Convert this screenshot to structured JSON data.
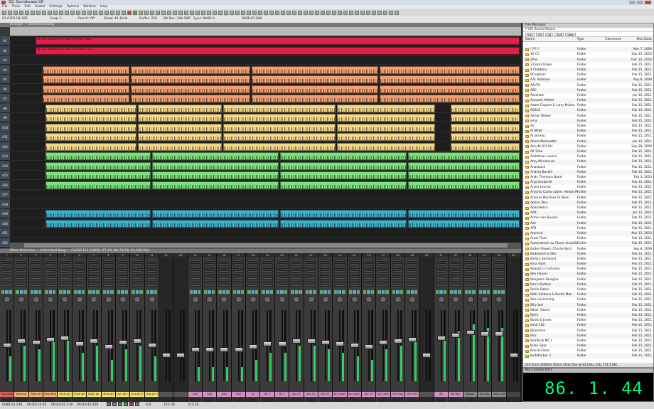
{
  "app": {
    "title": "SQ: Soundscape V8"
  },
  "menu": [
    "File",
    "Track",
    "Edit",
    "Global",
    "Settings",
    "Options",
    "Window",
    "Help"
  ],
  "info": {
    "position": "01 0101.04.285",
    "snap": "Snap: 1",
    "punch": "Punch: Off",
    "show": "Show: 44.1kHz",
    "buffer": "Buffer: 256",
    "bitres": "Bit Res: 24b SWF",
    "sync": "Sync: MADI A",
    "end": "0006.01.000"
  },
  "arrange": {
    "title": "Arrange — Unfinished Song",
    "tracks": [
      "A1",
      "A2",
      "A3",
      "A4",
      "A5",
      "A6",
      "A7",
      "A8",
      "A9",
      "A10",
      "A11",
      "A12",
      "A13",
      "A14",
      "A15",
      "A16",
      "A17",
      "A18",
      "A19",
      "A20",
      "A21",
      "A22"
    ],
    "clip_labels": {
      "red1": "Vox Alt – Autoxm MIO: Send Pre/Post – Mute",
      "red2": "Vox Alt – Autoxm MIO: Multi FX 4 Bank – Ch 4"
    }
  },
  "filebrowser": {
    "title": "File Manager",
    "path": "F:\\05 Runed Music\\",
    "tools": [
      "Sort",
      "Fld",
      "Up",
      "Sort",
      "View"
    ],
    "columns": {
      "name": "Name",
      "type": "Type",
      "comment": "Comment",
      "date": "Mod Date"
    },
    "rows": [
      {
        "name": "..",
        "type": "",
        "date": ""
      },
      {
        "name": "!!!!!!!",
        "type": "Folder",
        "date": "Nov 7, 2009"
      },
      {
        "name": "10 CC",
        "type": "Folder",
        "date": "Sep 15, 2010"
      },
      {
        "name": "2Pac",
        "type": "Folder",
        "date": "Dec 14, 2010"
      },
      {
        "name": "3 Doors Down",
        "type": "Folder",
        "date": "Feb 15, 2011"
      },
      {
        "name": "4 Clubbers",
        "type": "Folder",
        "date": "Feb 15, 2011"
      },
      {
        "name": "8Clubbers",
        "type": "Folder",
        "date": "Feb 15, 2011"
      },
      {
        "name": "A.R. Rahman",
        "type": "Folder",
        "date": "Aug 8, 2009"
      },
      {
        "name": "AALTO",
        "type": "Folder",
        "date": "Feb 15, 2011"
      },
      {
        "name": "ABC",
        "type": "Folder",
        "date": "Feb 15, 2011"
      },
      {
        "name": "Abraham",
        "type": "Folder",
        "date": "Jan 10, 2011"
      },
      {
        "name": "Acoustic Affaire",
        "type": "Folder",
        "date": "Feb 15, 2011"
      },
      {
        "name": "Adam Clayton & Larry Mullen",
        "type": "Folder",
        "date": "Feb 15, 2011"
      },
      {
        "name": "ADELE",
        "type": "Folder",
        "date": "Feb 15, 2011"
      },
      {
        "name": "Adrian Bieber",
        "type": "Folder",
        "date": "Feb 15, 2011"
      },
      {
        "name": "a-ha",
        "type": "Folder",
        "date": "Feb 15, 2011"
      },
      {
        "name": "Air",
        "type": "Folder",
        "date": "Feb 15, 2011"
      },
      {
        "name": "Al Miller",
        "type": "Folder",
        "date": "Feb 15, 2011"
      },
      {
        "name": "Al Jarreau",
        "type": "Folder",
        "date": "Feb 15, 2011"
      },
      {
        "name": "Alanis Morissette",
        "type": "Folder",
        "date": "Jan 12, 2011"
      },
      {
        "name": "Alex M.O.R.P.H.",
        "type": "Folder",
        "date": "Sep 28, 2009"
      },
      {
        "name": "All Time",
        "type": "Folder",
        "date": "Feb 15, 2011"
      },
      {
        "name": "Ambitious Lovers",
        "type": "Folder",
        "date": "Feb 15, 2011"
      },
      {
        "name": "Amy Winehouse",
        "type": "Folder",
        "date": "Feb 15, 2011"
      },
      {
        "name": "Anastacia",
        "type": "Folder",
        "date": "Feb 15, 2011"
      },
      {
        "name": "Andrea Bocelli",
        "type": "Folder",
        "date": "Feb 15, 2011"
      },
      {
        "name": "Andy Timmons Band",
        "type": "Folder",
        "date": "Feb 3, 2010"
      },
      {
        "name": "Anja Garbarek",
        "type": "Folder",
        "date": "Feb 15, 2011"
      },
      {
        "name": "Annie Lennox",
        "type": "Folder",
        "date": "Feb 15, 2011"
      },
      {
        "name": "Antonio Carlos Jobim, Herbie H",
        "type": "Folder",
        "date": "Feb 15, 2011"
      },
      {
        "name": "Antonio Martinez Di Nonu",
        "type": "Folder",
        "date": "Feb 15, 2011"
      },
      {
        "name": "Aphex Twin",
        "type": "Folder",
        "date": "Feb 15, 2011"
      },
      {
        "name": "Aphrodelics",
        "type": "Folder",
        "date": "Feb 15, 2011"
      },
      {
        "name": "ARK",
        "type": "Folder",
        "date": "Jan 12, 2011"
      },
      {
        "name": "Armin van Buuren",
        "type": "Folder",
        "date": "Feb 15, 2011"
      },
      {
        "name": "Ash",
        "type": "Folder",
        "date": "Feb 15, 2011"
      },
      {
        "name": "ATB",
        "type": "Folder",
        "date": "Feb 15, 2011"
      },
      {
        "name": "Atomica",
        "type": "Folder",
        "date": "Mar 12, 2010"
      },
      {
        "name": "Aural Float",
        "type": "Folder",
        "date": "Feb 15, 2011"
      },
      {
        "name": "Automatisch zu iTunes hinzufügen",
        "type": "Folder",
        "date": "Feb 15, 2011"
      },
      {
        "name": "Baden Powell, Charlie Byrd",
        "type": "Folder",
        "date": "Sep 8, 2009"
      },
      {
        "name": "Badmarsh & Shri",
        "type": "Folder",
        "date": "Feb 15, 2011"
      },
      {
        "name": "Barbra Streisand",
        "type": "Folder",
        "date": "Feb 15, 2011"
      },
      {
        "name": "Bass Funk",
        "type": "Folder",
        "date": "Feb 15, 2011"
      },
      {
        "name": "Beauty's Confusion",
        "type": "Folder",
        "date": "Feb 15, 2011"
      },
      {
        "name": "Ben Harper",
        "type": "Folder",
        "date": "Feb 15, 2011"
      },
      {
        "name": "Benjamin Devigne",
        "type": "Folder",
        "date": "Feb 15, 2011"
      },
      {
        "name": "Ben's Brother",
        "type": "Folder",
        "date": "Feb 15, 2011"
      },
      {
        "name": "Berlin-Bahia",
        "type": "Folder",
        "date": "Feb 15, 2011"
      },
      {
        "name": "Beth Gibbons & Rustin Man",
        "type": "Folder",
        "date": "Feb 15, 2011"
      },
      {
        "name": "Bez Lee Harling",
        "type": "Folder",
        "date": "Feb 15, 2011"
      },
      {
        "name": "Billy Joel",
        "type": "Folder",
        "date": "Feb 15, 2011"
      },
      {
        "name": "Bitter_Sweet",
        "type": "Folder",
        "date": "Feb 15, 2011"
      },
      {
        "name": "Björk",
        "type": "Folder",
        "date": "Feb 15, 2011"
      },
      {
        "name": "Blank & Jones",
        "type": "Folder",
        "date": "Feb 15, 2011"
      },
      {
        "name": "blink-182",
        "type": "Folder",
        "date": "Feb 15, 2011"
      },
      {
        "name": "Blümchen",
        "type": "Folder",
        "date": "Feb 15, 2011"
      },
      {
        "name": "Blur",
        "type": "Folder",
        "date": "Feb 15, 2011"
      },
      {
        "name": "Bomfunk MC's",
        "type": "Folder",
        "date": "Feb 15, 2011"
      },
      {
        "name": "Brian Tyler",
        "type": "Folder",
        "date": "Feb 15, 2011"
      },
      {
        "name": "Bronski Beat",
        "type": "Folder",
        "date": "Feb 15, 2011"
      },
      {
        "name": "buddha bar 3",
        "type": "Folder",
        "date": "Feb 15, 2011"
      },
      {
        "name": "Buddah Bar III",
        "type": "Folder",
        "date": "Feb 15, 2011"
      },
      {
        "name": "Buddah Bar IV",
        "type": "Folder",
        "date": "Feb 15, 2011"
      },
      {
        "name": "Buddha Bar",
        "type": "Folder",
        "date": "Feb 15, 2011"
      }
    ],
    "status": "516 Items (840Hrs 30min 31sec free @ 44.1kHz, 24b, 151.5 GB)"
  },
  "counter": {
    "title": "Big Counter Bars",
    "value": "86. 1. 44"
  },
  "mixer": {
    "title": "Mixer Overview — Unfinished Song — CLEAR 111 [100% /77.2% NU:74.6% Ch.100.0%]",
    "strips": [
      {
        "num": "1",
        "name": "Cow lead",
        "color": "#e06060",
        "level": 0.35
      },
      {
        "num": "2",
        "name": "Bass alt",
        "color": "#f0b070",
        "level": 0.5
      },
      {
        "num": "3",
        "name": "Bass alt",
        "color": "#f0b070",
        "level": 0.45
      },
      {
        "num": "4",
        "name": "Bass RHS",
        "color": "#f0b070",
        "level": 0.55
      },
      {
        "num": "5",
        "name": "Gtlub gtr",
        "color": "#f0e070",
        "level": 0.6
      },
      {
        "num": "6",
        "name": "Gtlub gtr",
        "color": "#f0e070",
        "level": 0.4
      },
      {
        "num": "7",
        "name": "Gtlub gtr",
        "color": "#f0e070",
        "level": 0.5
      },
      {
        "num": "8",
        "name": "Gtlub gtr",
        "color": "#f0e070",
        "level": 0.3
      },
      {
        "num": "9",
        "name": "Line gtr 1",
        "color": "#f0e070",
        "level": 0.45
      },
      {
        "num": "10",
        "name": "Line gtr 2",
        "color": "#f0e070",
        "level": 0.5
      },
      {
        "num": "11",
        "name": "Line gtr 3",
        "color": "#f0e070",
        "level": 0.35
      },
      {
        "num": "12",
        "name": "",
        "color": "#555555",
        "level": 0.0
      },
      {
        "num": "13",
        "name": "",
        "color": "#555555",
        "level": 0.0
      },
      {
        "num": "14",
        "name": "Hall",
        "color": "#d090c0",
        "level": 0.2
      },
      {
        "num": "15",
        "name": "Hall",
        "color": "#d090c0",
        "level": 0.2
      },
      {
        "num": "16",
        "name": "Hall",
        "color": "#d090c0",
        "level": 0.2
      },
      {
        "num": "17",
        "name": "Hall",
        "color": "#d090c0",
        "level": 0.2
      },
      {
        "num": "18",
        "name": "LV",
        "color": "#d090c0",
        "level": 0.3
      },
      {
        "num": "19",
        "name": "BV 1",
        "color": "#d090c0",
        "level": 0.4
      },
      {
        "num": "20",
        "name": "BV 1",
        "color": "#d090c0",
        "level": 0.4
      },
      {
        "num": "21",
        "name": "Acc 01",
        "color": "#d090c0",
        "level": 0.5
      },
      {
        "num": "22",
        "name": "Acc 01",
        "color": "#d090c0",
        "level": 0.5
      },
      {
        "num": "23",
        "name": "Acc 01",
        "color": "#d090c0",
        "level": 0.45
      },
      {
        "num": "24",
        "name": "Acc Upon",
        "color": "#d090c0",
        "level": 0.4
      },
      {
        "num": "25",
        "name": "Acc Upon",
        "color": "#d090c0",
        "level": 0.35
      },
      {
        "num": "26",
        "name": "Acc 01",
        "color": "#d090c0",
        "level": 0.3
      },
      {
        "num": "27",
        "name": "Acc Upon",
        "color": "#d090c0",
        "level": 0.45
      },
      {
        "num": "28",
        "name": "Clnt map",
        "color": "#d090c0",
        "level": 0.5
      },
      {
        "num": "29",
        "name": "Clnk FX2",
        "color": "#d090c0",
        "level": 0.55
      },
      {
        "num": "30",
        "name": "",
        "color": "#555555",
        "level": 0.0
      },
      {
        "num": "31",
        "name": "BB",
        "color": "#d090c0",
        "level": 0.6
      },
      {
        "num": "32",
        "name": "BB Rev",
        "color": "#d090c0",
        "level": 0.7
      },
      {
        "num": "33",
        "name": "Master",
        "color": "#888888",
        "level": 0.8
      },
      {
        "num": "34",
        "name": "Pre Bus",
        "color": "#888888",
        "level": 0.75
      },
      {
        "num": "35",
        "name": "Main Out",
        "color": "#888888",
        "level": 0.75
      },
      {
        "num": "36",
        "name": "",
        "color": "#444444",
        "level": 0.0
      }
    ]
  },
  "transport": {
    "pos1": "0086.01.044",
    "pos2": "00:02:14.05",
    "pos3": "00:03:01.278",
    "pos4": "00:03:45.450",
    "sig": "4/4",
    "bpm": "152.00",
    "extra": "4.5.16"
  },
  "colors": {
    "red": "#e0204a",
    "orange": "#f0a070",
    "yellow": "#f4d88a",
    "green": "#7ee07a",
    "teal": "#3fb0c8"
  }
}
